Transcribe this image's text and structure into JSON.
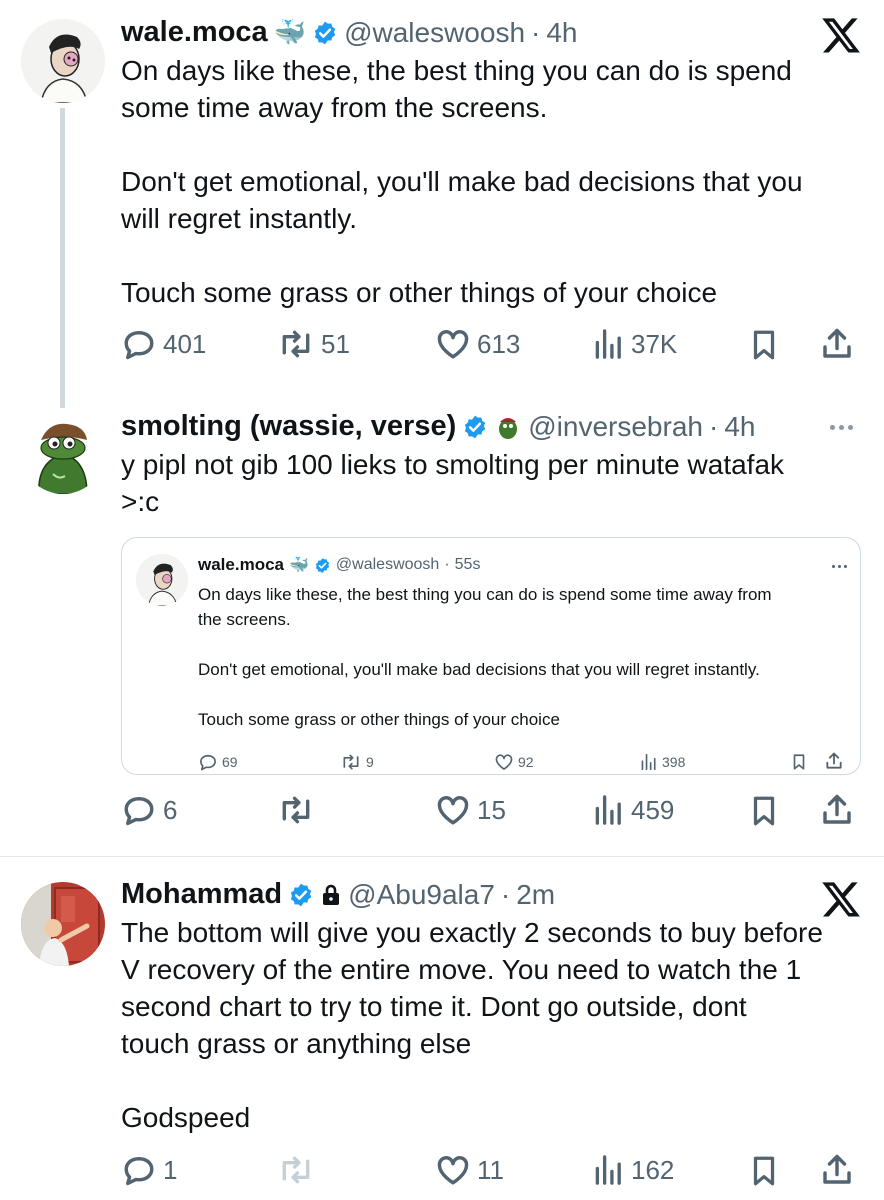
{
  "tweet1": {
    "display_name": "wale.moca",
    "name_emoji": "🐳",
    "handle": "@waleswoosh",
    "time": "4h",
    "text": "On days like these, the best thing you can do is spend\nsome time away from the screens.\n\nDon't get emotional, you'll make bad decisions that you\nwill regret instantly.\n\nTouch some grass or other things of your choice",
    "replies": "401",
    "reposts": "51",
    "likes": "613",
    "views": "37K"
  },
  "tweet2": {
    "display_name": "smolting (wassie, verse)",
    "handle": "@inversebrah",
    "time": "4h",
    "text": "y pipl not gib 100 lieks to smolting per minute watafak\n>:c",
    "replies": "6",
    "likes": "15",
    "views": "459",
    "quote": {
      "display_name": "wale.moca",
      "handle": "@waleswoosh",
      "time": "55s",
      "text": "On days like these, the best thing you can do is spend some time away from\nthe screens.\n\nDon't get emotional, you'll make bad decisions that you will regret instantly.\n\nTouch some grass or other things of your choice",
      "replies": "69",
      "reposts": "9",
      "likes": "92",
      "views": "398"
    }
  },
  "tweet3": {
    "display_name": "Mohammad",
    "handle": "@Abu9ala7",
    "time": "2m",
    "text": "The bottom will give you exactly 2 seconds to buy before\nV recovery of the entire move. You need to watch the 1\nsecond chart to try to time it. Dont go outside, dont\ntouch grass or anything else\n\nGodspeed",
    "replies": "1",
    "likes": "11",
    "views": "162"
  },
  "separator": "·",
  "colors": {
    "verified": "#1d9bf0",
    "secondary_text": "#536471",
    "divider": "#e6e8ea"
  }
}
